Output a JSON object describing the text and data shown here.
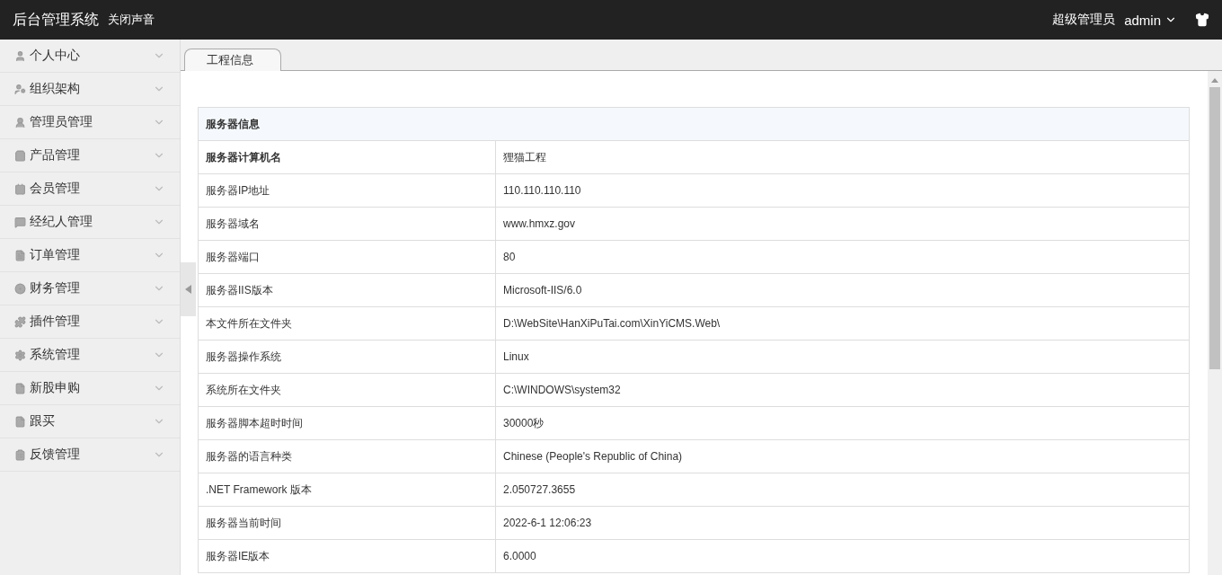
{
  "header": {
    "title": "后台管理系统",
    "sound_toggle": "关闭声音",
    "role": "超级管理员",
    "user": "admin"
  },
  "sidebar": {
    "items": [
      {
        "label": "个人中心"
      },
      {
        "label": "组织架构"
      },
      {
        "label": "管理员管理"
      },
      {
        "label": "产品管理"
      },
      {
        "label": "会员管理"
      },
      {
        "label": "经纪人管理"
      },
      {
        "label": "订单管理"
      },
      {
        "label": "财务管理"
      },
      {
        "label": "插件管理"
      },
      {
        "label": "系统管理"
      },
      {
        "label": "新股申购"
      },
      {
        "label": "跟买"
      },
      {
        "label": "反馈管理"
      }
    ]
  },
  "tabs": [
    {
      "label": "工程信息",
      "selected": true
    }
  ],
  "table": {
    "title": "服务器信息",
    "rows": [
      {
        "label": "服务器计算机名",
        "value": "狸猫工程",
        "bold": true
      },
      {
        "label": "服务器IP地址",
        "value": "110.110.110.110",
        "bold": false
      },
      {
        "label": "服务器域名",
        "value": "www.hmxz.gov",
        "bold": false
      },
      {
        "label": "服务器端口",
        "value": "80",
        "bold": false
      },
      {
        "label": "服务器IIS版本",
        "value": "Microsoft-IIS/6.0",
        "bold": false
      },
      {
        "label": "本文件所在文件夹",
        "value": "D:\\WebSite\\HanXiPuTai.com\\XinYiCMS.Web\\",
        "bold": false
      },
      {
        "label": "服务器操作系统",
        "value": "Linux",
        "bold": false
      },
      {
        "label": "系统所在文件夹",
        "value": "C:\\WINDOWS\\system32",
        "bold": false
      },
      {
        "label": "服务器脚本超时时间",
        "value": "30000秒",
        "bold": false
      },
      {
        "label": "服务器的语言种类",
        "value": "Chinese (People's Republic of China)",
        "bold": false
      },
      {
        "label": ".NET Framework 版本",
        "value": "2.050727.3655",
        "bold": false
      },
      {
        "label": "服务器当前时间",
        "value": "2022-6-1 12:06:23",
        "bold": false
      },
      {
        "label": "服务器IE版本",
        "value": "6.0000",
        "bold": false
      }
    ]
  }
}
